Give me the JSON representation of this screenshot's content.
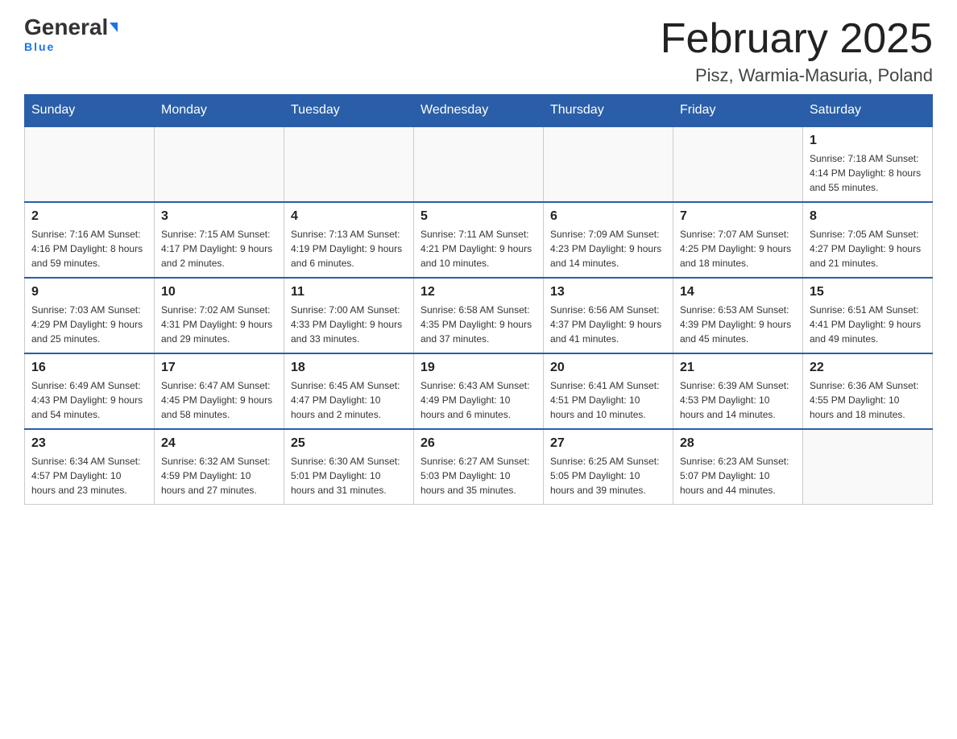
{
  "header": {
    "logo": {
      "general": "General",
      "blue": "Blue",
      "underline": "Blue"
    },
    "title": "February 2025",
    "subtitle": "Pisz, Warmia-Masuria, Poland"
  },
  "days_of_week": [
    "Sunday",
    "Monday",
    "Tuesday",
    "Wednesday",
    "Thursday",
    "Friday",
    "Saturday"
  ],
  "weeks": [
    [
      {
        "day": "",
        "info": ""
      },
      {
        "day": "",
        "info": ""
      },
      {
        "day": "",
        "info": ""
      },
      {
        "day": "",
        "info": ""
      },
      {
        "day": "",
        "info": ""
      },
      {
        "day": "",
        "info": ""
      },
      {
        "day": "1",
        "info": "Sunrise: 7:18 AM\nSunset: 4:14 PM\nDaylight: 8 hours and 55 minutes."
      }
    ],
    [
      {
        "day": "2",
        "info": "Sunrise: 7:16 AM\nSunset: 4:16 PM\nDaylight: 8 hours and 59 minutes."
      },
      {
        "day": "3",
        "info": "Sunrise: 7:15 AM\nSunset: 4:17 PM\nDaylight: 9 hours and 2 minutes."
      },
      {
        "day": "4",
        "info": "Sunrise: 7:13 AM\nSunset: 4:19 PM\nDaylight: 9 hours and 6 minutes."
      },
      {
        "day": "5",
        "info": "Sunrise: 7:11 AM\nSunset: 4:21 PM\nDaylight: 9 hours and 10 minutes."
      },
      {
        "day": "6",
        "info": "Sunrise: 7:09 AM\nSunset: 4:23 PM\nDaylight: 9 hours and 14 minutes."
      },
      {
        "day": "7",
        "info": "Sunrise: 7:07 AM\nSunset: 4:25 PM\nDaylight: 9 hours and 18 minutes."
      },
      {
        "day": "8",
        "info": "Sunrise: 7:05 AM\nSunset: 4:27 PM\nDaylight: 9 hours and 21 minutes."
      }
    ],
    [
      {
        "day": "9",
        "info": "Sunrise: 7:03 AM\nSunset: 4:29 PM\nDaylight: 9 hours and 25 minutes."
      },
      {
        "day": "10",
        "info": "Sunrise: 7:02 AM\nSunset: 4:31 PM\nDaylight: 9 hours and 29 minutes."
      },
      {
        "day": "11",
        "info": "Sunrise: 7:00 AM\nSunset: 4:33 PM\nDaylight: 9 hours and 33 minutes."
      },
      {
        "day": "12",
        "info": "Sunrise: 6:58 AM\nSunset: 4:35 PM\nDaylight: 9 hours and 37 minutes."
      },
      {
        "day": "13",
        "info": "Sunrise: 6:56 AM\nSunset: 4:37 PM\nDaylight: 9 hours and 41 minutes."
      },
      {
        "day": "14",
        "info": "Sunrise: 6:53 AM\nSunset: 4:39 PM\nDaylight: 9 hours and 45 minutes."
      },
      {
        "day": "15",
        "info": "Sunrise: 6:51 AM\nSunset: 4:41 PM\nDaylight: 9 hours and 49 minutes."
      }
    ],
    [
      {
        "day": "16",
        "info": "Sunrise: 6:49 AM\nSunset: 4:43 PM\nDaylight: 9 hours and 54 minutes."
      },
      {
        "day": "17",
        "info": "Sunrise: 6:47 AM\nSunset: 4:45 PM\nDaylight: 9 hours and 58 minutes."
      },
      {
        "day": "18",
        "info": "Sunrise: 6:45 AM\nSunset: 4:47 PM\nDaylight: 10 hours and 2 minutes."
      },
      {
        "day": "19",
        "info": "Sunrise: 6:43 AM\nSunset: 4:49 PM\nDaylight: 10 hours and 6 minutes."
      },
      {
        "day": "20",
        "info": "Sunrise: 6:41 AM\nSunset: 4:51 PM\nDaylight: 10 hours and 10 minutes."
      },
      {
        "day": "21",
        "info": "Sunrise: 6:39 AM\nSunset: 4:53 PM\nDaylight: 10 hours and 14 minutes."
      },
      {
        "day": "22",
        "info": "Sunrise: 6:36 AM\nSunset: 4:55 PM\nDaylight: 10 hours and 18 minutes."
      }
    ],
    [
      {
        "day": "23",
        "info": "Sunrise: 6:34 AM\nSunset: 4:57 PM\nDaylight: 10 hours and 23 minutes."
      },
      {
        "day": "24",
        "info": "Sunrise: 6:32 AM\nSunset: 4:59 PM\nDaylight: 10 hours and 27 minutes."
      },
      {
        "day": "25",
        "info": "Sunrise: 6:30 AM\nSunset: 5:01 PM\nDaylight: 10 hours and 31 minutes."
      },
      {
        "day": "26",
        "info": "Sunrise: 6:27 AM\nSunset: 5:03 PM\nDaylight: 10 hours and 35 minutes."
      },
      {
        "day": "27",
        "info": "Sunrise: 6:25 AM\nSunset: 5:05 PM\nDaylight: 10 hours and 39 minutes."
      },
      {
        "day": "28",
        "info": "Sunrise: 6:23 AM\nSunset: 5:07 PM\nDaylight: 10 hours and 44 minutes."
      },
      {
        "day": "",
        "info": ""
      }
    ]
  ]
}
